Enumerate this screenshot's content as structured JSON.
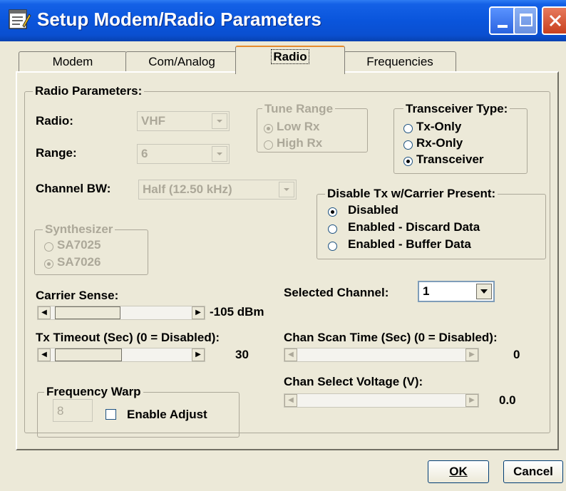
{
  "window": {
    "title": "Setup Modem/Radio Parameters"
  },
  "tabs": [
    {
      "label": "Modem",
      "active": false
    },
    {
      "label": "Com/Analog",
      "active": false
    },
    {
      "label": "Radio",
      "active": true
    },
    {
      "label": "Frequencies",
      "active": false
    }
  ],
  "radio_parameters": {
    "group_label": "Radio Parameters:",
    "radio_label": "Radio:",
    "radio_value": "VHF",
    "range_label": "Range:",
    "range_value": "6",
    "channel_bw_label": "Channel BW:",
    "channel_bw_value": "Half (12.50 kHz)"
  },
  "tune_range": {
    "label": "Tune Range",
    "options": [
      {
        "label": "Low Rx",
        "selected": true
      },
      {
        "label": "High Rx",
        "selected": false
      }
    ]
  },
  "transceiver_type": {
    "label": "Transceiver Type:",
    "options": [
      {
        "label": "Tx-Only",
        "selected": false
      },
      {
        "label": "Rx-Only",
        "selected": false
      },
      {
        "label": "Transceiver",
        "selected": true
      }
    ]
  },
  "disable_tx": {
    "label": "Disable Tx w/Carrier Present:",
    "options": [
      {
        "label": "Disabled",
        "selected": true
      },
      {
        "label": "Enabled - Discard Data",
        "selected": false
      },
      {
        "label": "Enabled - Buffer Data",
        "selected": false
      }
    ]
  },
  "synthesizer": {
    "label": "Synthesizer",
    "options": [
      {
        "label": "SA7025",
        "selected": false
      },
      {
        "label": "SA7026",
        "selected": true
      }
    ]
  },
  "carrier_sense": {
    "label": "Carrier Sense:",
    "value_text": "-105 dBm"
  },
  "tx_timeout": {
    "label": "Tx Timeout (Sec) (0 = Disabled):",
    "value_text": "30"
  },
  "selected_channel": {
    "label": "Selected Channel:",
    "value": "1"
  },
  "chan_scan_time": {
    "label": "Chan Scan Time (Sec) (0 = Disabled):",
    "value_text": "0"
  },
  "chan_select_voltage": {
    "label": "Chan Select Voltage (V):",
    "value_text": "0.0"
  },
  "frequency_warp": {
    "label": "Frequency Warp",
    "value": "8",
    "enable_adjust_label": "Enable Adjust",
    "enable_adjust_checked": false
  },
  "buttons": {
    "ok": "OK",
    "cancel": "Cancel"
  }
}
